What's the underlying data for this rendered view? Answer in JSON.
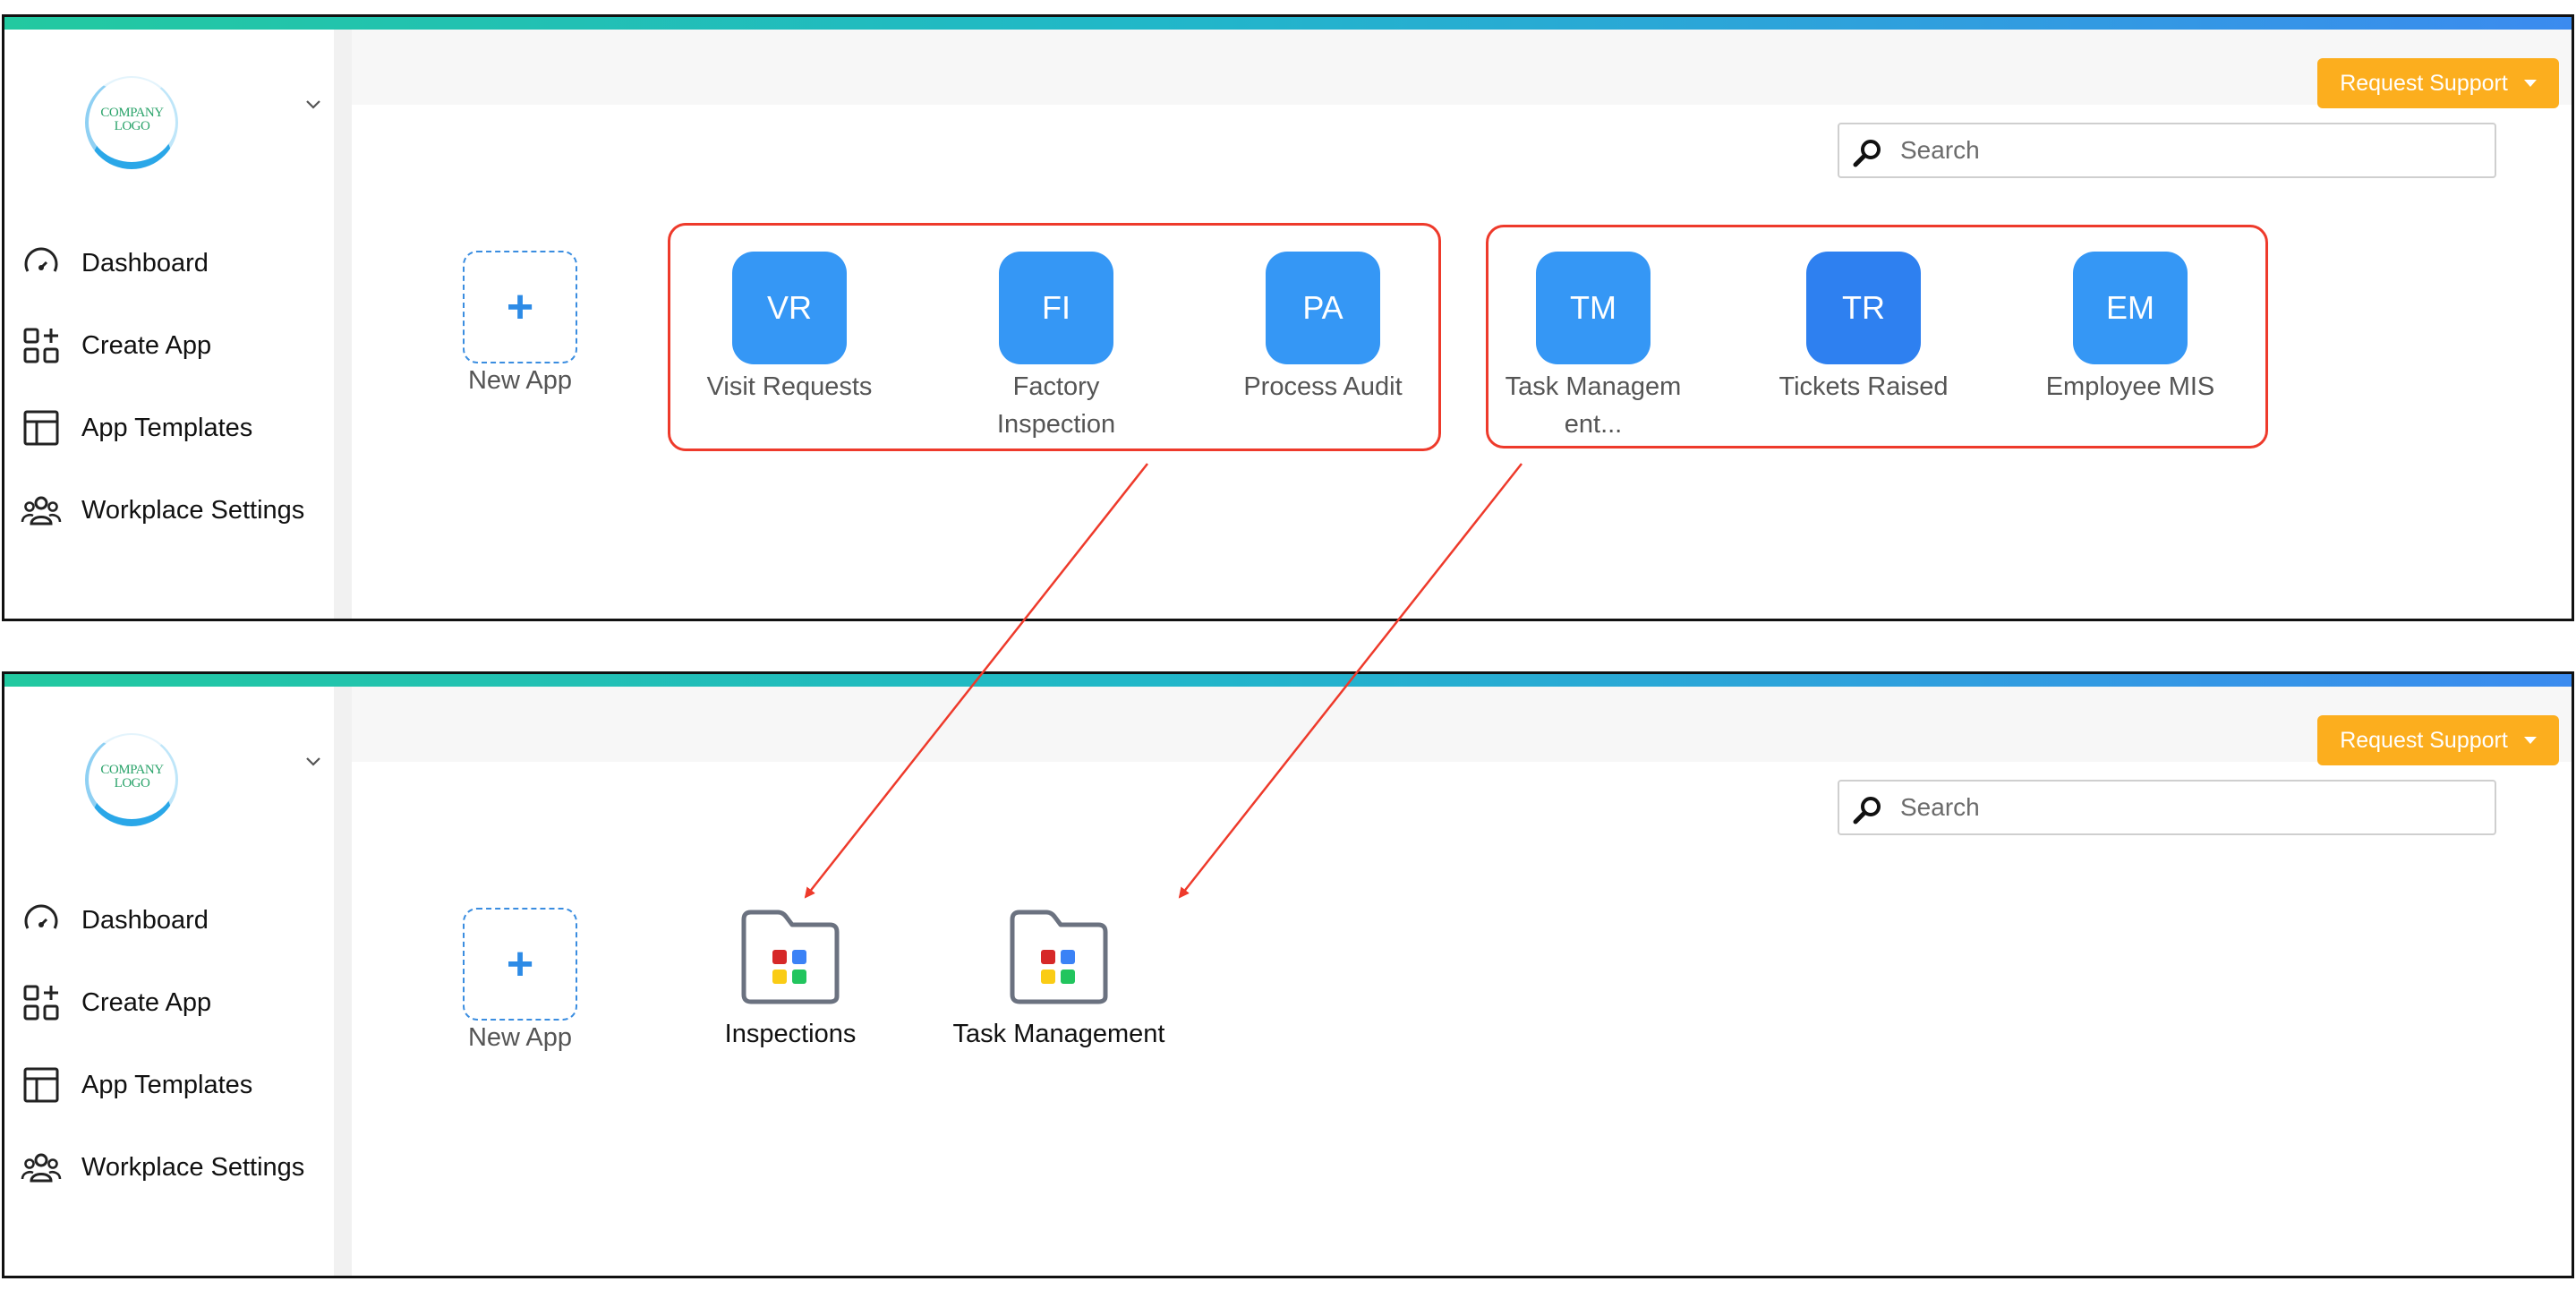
{
  "logo": {
    "line1": "COMPANY",
    "line2": "LOGO"
  },
  "sidebar": {
    "items": [
      {
        "label": "Dashboard",
        "icon": "gauge-icon"
      },
      {
        "label": "Create App",
        "icon": "grid-plus-icon"
      },
      {
        "label": "App Templates",
        "icon": "template-icon"
      },
      {
        "label": "Workplace Settings",
        "icon": "users-icon"
      }
    ]
  },
  "header": {
    "support_label": "Request Support"
  },
  "search": {
    "placeholder": "Search"
  },
  "new_app": {
    "label": "New App"
  },
  "before": {
    "groups": [
      {
        "apps": [
          {
            "abbr": "VR",
            "name": "Visit Requests"
          },
          {
            "abbr": "FI",
            "name": "Factory Inspection"
          },
          {
            "abbr": "PA",
            "name": "Process Audit"
          }
        ]
      },
      {
        "apps": [
          {
            "abbr": "TM",
            "name": "Task Management..."
          },
          {
            "abbr": "TR",
            "name": "Tickets Raised"
          },
          {
            "abbr": "EM",
            "name": "Employee MIS"
          }
        ]
      }
    ]
  },
  "after": {
    "folders": [
      {
        "name": "Inspections"
      },
      {
        "name": "Task Management"
      }
    ]
  },
  "colors": {
    "accent": "#3597f5",
    "support": "#fcae1e",
    "highlight": "#ee3a2b",
    "folder_dots": [
      "#d62828",
      "#3b82f6",
      "#facc15",
      "#22c55e"
    ]
  }
}
